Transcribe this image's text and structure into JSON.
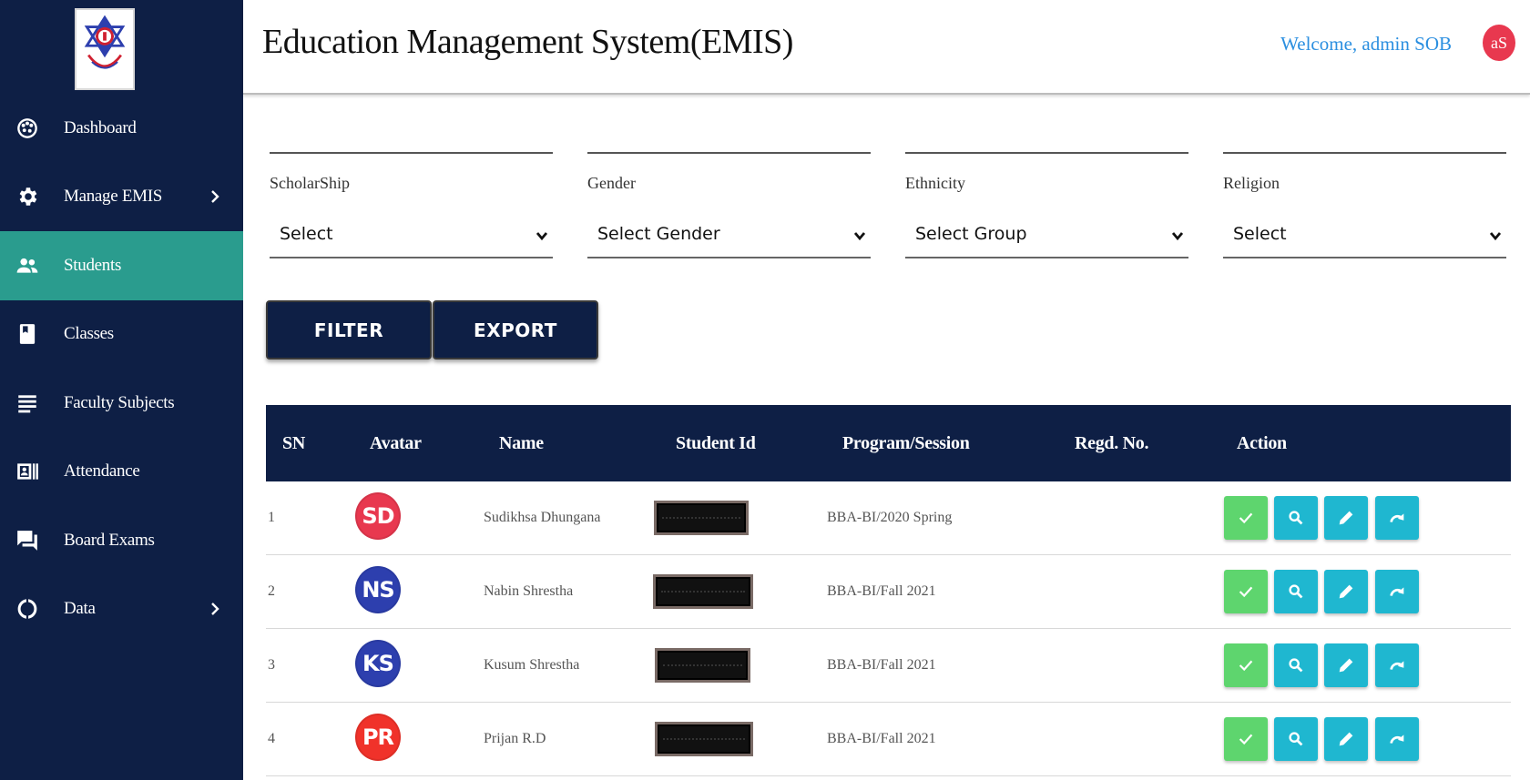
{
  "header": {
    "title": "Education Management System(EMIS)",
    "welcome": "Welcome, admin SOB",
    "user_initials": "aS"
  },
  "sidebar": {
    "items": [
      {
        "label": "Dashboard",
        "icon": "palette-icon",
        "active": false,
        "has_submenu": false
      },
      {
        "label": "Manage EMIS",
        "icon": "gear-icon",
        "active": false,
        "has_submenu": true
      },
      {
        "label": "Students",
        "icon": "people-icon",
        "active": true,
        "has_submenu": false
      },
      {
        "label": "Classes",
        "icon": "book-icon",
        "active": false,
        "has_submenu": false
      },
      {
        "label": "Faculty Subjects",
        "icon": "list-icon",
        "active": false,
        "has_submenu": false
      },
      {
        "label": "Attendance",
        "icon": "id-card-icon",
        "active": false,
        "has_submenu": false
      },
      {
        "label": "Board Exams",
        "icon": "chat-icon",
        "active": false,
        "has_submenu": false
      },
      {
        "label": "Data",
        "icon": "donut-icon",
        "active": false,
        "has_submenu": true
      }
    ]
  },
  "filters": {
    "scholarship": {
      "label": "ScholarShip",
      "value": "Select"
    },
    "gender": {
      "label": "Gender",
      "value": "Select Gender"
    },
    "ethnicity": {
      "label": "Ethnicity",
      "value": "Select Group"
    },
    "religion": {
      "label": "Religion",
      "value": "Select"
    }
  },
  "buttons": {
    "filter": "FILTER",
    "export": "EXPORT"
  },
  "table": {
    "columns": [
      "SN",
      "Avatar",
      "Name",
      "Student Id",
      "Program/Session",
      "Regd. No.",
      "Action"
    ],
    "rows": [
      {
        "sn": "1",
        "initials": "SD",
        "avatar_color": "#e8384f",
        "name": "Sudikhsa Dhungana",
        "program": "BBA-BI/2020 Spring",
        "regd": ""
      },
      {
        "sn": "2",
        "initials": "NS",
        "avatar_color": "#2d3fae",
        "name": "Nabin Shrestha",
        "program": "BBA-BI/Fall 2021",
        "regd": ""
      },
      {
        "sn": "3",
        "initials": "KS",
        "avatar_color": "#2d3fae",
        "name": "Kusum Shrestha",
        "program": "BBA-BI/Fall 2021",
        "regd": ""
      },
      {
        "sn": "4",
        "initials": "PR",
        "avatar_color": "#f0322a",
        "name": "Prijan R.D",
        "program": "BBA-BI/Fall 2021",
        "regd": ""
      }
    ]
  },
  "colors": {
    "sidebar_bg": "#0e1f45",
    "active_item": "#2a9c8e",
    "welcome_text": "#2b8fe0",
    "approve_button": "#5ed56e",
    "action_button": "#1fb7d0"
  }
}
